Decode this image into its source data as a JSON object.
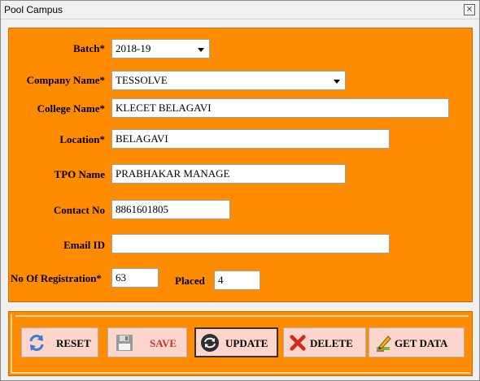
{
  "window": {
    "title": "Pool Campus",
    "close_glyph": "×"
  },
  "form": {
    "batch": {
      "label": "Batch*",
      "value": "2018-19"
    },
    "company": {
      "label": "Company Name*",
      "value": "TESSOLVE"
    },
    "college": {
      "label": "College Name*",
      "value": "KLECET BELAGAVI"
    },
    "location": {
      "label": "Location*",
      "value": "BELAGAVI"
    },
    "tpo": {
      "label": "TPO Name",
      "value": "PRABHAKAR MANAGE"
    },
    "contact": {
      "label": "Contact No",
      "value": "8861601805"
    },
    "email": {
      "label": "Email ID",
      "value": ""
    },
    "registrations": {
      "label": "No Of Registration*",
      "value": "63"
    },
    "placed": {
      "label": "Placed",
      "value": "4"
    }
  },
  "buttons": {
    "reset": {
      "label": "RESET",
      "icon": "refresh-icon"
    },
    "save": {
      "label": "SAVE",
      "icon": "floppy-disk-icon",
      "color": "#c0392b"
    },
    "update": {
      "label": "UPDATE",
      "icon": "update-cycle-icon"
    },
    "delete": {
      "label": "DELETE",
      "icon": "red-x-icon"
    },
    "get_data": {
      "label": "GET DATA",
      "icon": "edit-pencil-icon"
    }
  },
  "colors": {
    "panel": "#ff8c00",
    "button_bg": "#fcd5cd",
    "accent_red": "#d22a1e"
  }
}
